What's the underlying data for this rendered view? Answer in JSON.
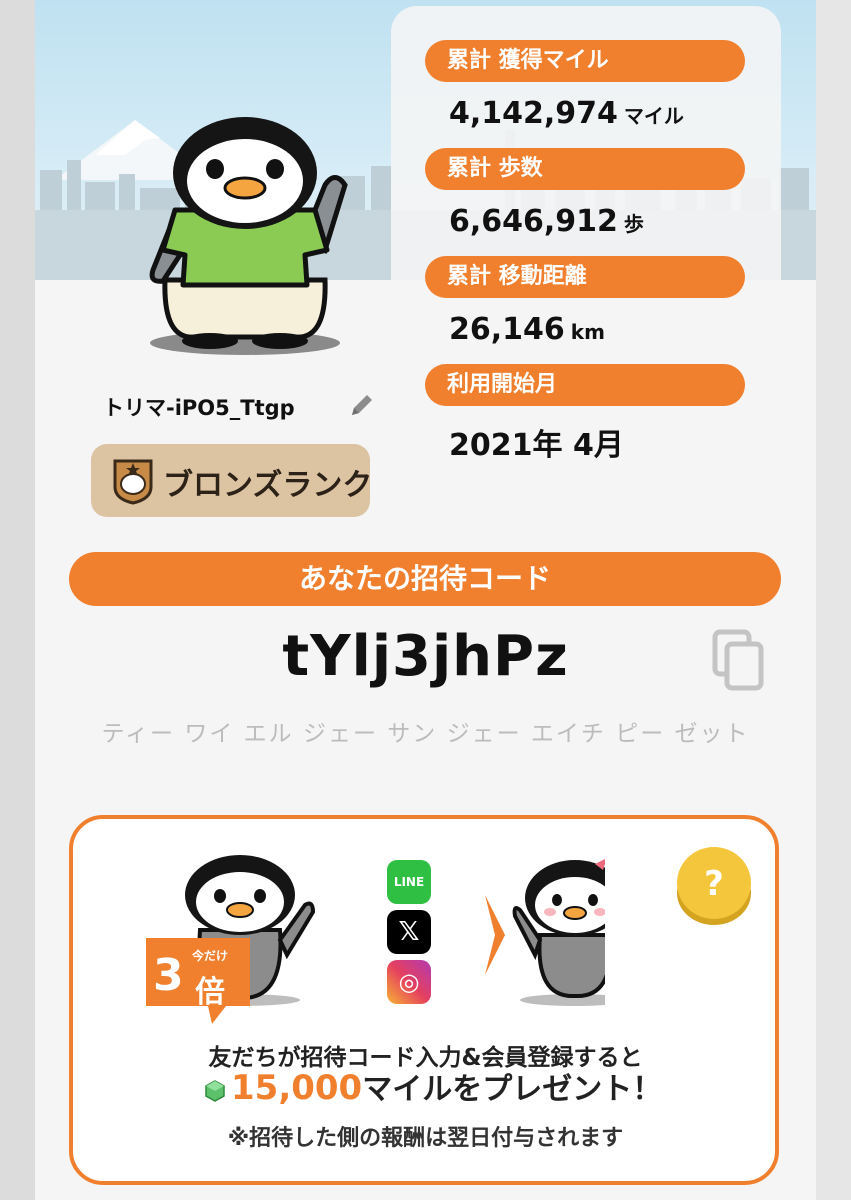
{
  "profile": {
    "username": "トリマ-iPO5_Ttgp",
    "rank_label": "ブロンズランク"
  },
  "stats": [
    {
      "label": "累計 獲得マイル",
      "value": "4,142,974",
      "unit": "マイル"
    },
    {
      "label": "累計 歩数",
      "value": "6,646,912",
      "unit": "歩"
    },
    {
      "label": "累計 移動距離",
      "value": "26,146",
      "unit": "km"
    },
    {
      "label": "利用開始月",
      "value": "2021年 4月",
      "unit": ""
    }
  ],
  "invite": {
    "title": "あなたの招待コード",
    "code": "tYlj3jhPz",
    "reading": "ティー ワイ エル ジェー サン ジェー エイチ ピー ゼット"
  },
  "promo": {
    "badge_now": "今だけ",
    "badge_num": "3",
    "badge_unit": "倍",
    "social_line": "LINE",
    "social_x": "𝕏",
    "social_ig": "◎",
    "line1": "友だちが招待コード入力&会員登録すると",
    "amount": "15,000",
    "line2_rest": "マイルをプレゼント！",
    "note": "※招待した側の報酬は翌日付与されます",
    "help_mark": "?"
  },
  "colors": {
    "accent": "#f07f2e",
    "rank_bg": "#dcc3a2"
  }
}
